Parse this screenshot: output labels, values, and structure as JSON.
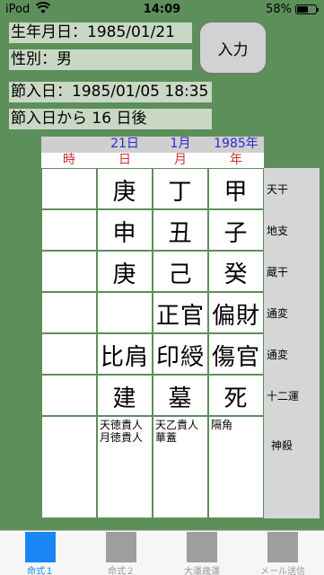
{
  "status": {
    "carrier": "iPod",
    "time": "14:09",
    "battery": "58%",
    "battery_level": 0.58
  },
  "info": {
    "birth": "生年月日：1985/01/21",
    "gender": "性別：男",
    "setsu": "節入日：1985/01/05 18:35",
    "days": "節入日から 16 日後"
  },
  "input_label": "入力",
  "columns": [
    {
      "date": "21日",
      "kind": "日"
    },
    {
      "date": "1月",
      "kind": "月"
    },
    {
      "date": "1985年",
      "kind": "年"
    }
  ],
  "hour_kind": "時",
  "colors": {
    "date": "#2a2ad0",
    "kind": "#d03030",
    "active_tab": "#1a86f5"
  },
  "rows": [
    {
      "label": "天干",
      "cells": [
        "",
        "庚",
        "丁",
        "甲"
      ]
    },
    {
      "label": "地支",
      "cells": [
        "",
        "申",
        "丑",
        "子"
      ]
    },
    {
      "label": "蔵干",
      "cells": [
        "",
        "庚",
        "己",
        "癸"
      ]
    },
    {
      "label": "通変",
      "cells": [
        "",
        "",
        "正官",
        "偏財"
      ]
    },
    {
      "label": "通変",
      "cells": [
        "",
        "比肩",
        "印綬",
        "傷官"
      ]
    },
    {
      "label": "十二運",
      "cells": [
        "",
        "建",
        "墓",
        "死"
      ]
    }
  ],
  "shinsatsu": {
    "label": "神殺",
    "cells": [
      "",
      "天徳貴人\n月徳貴人",
      "天乙貴人\n華蓋",
      "隔角"
    ]
  },
  "tabs": [
    {
      "label": "命式１",
      "active": true
    },
    {
      "label": "命式２",
      "active": false
    },
    {
      "label": "大運歳運",
      "active": false
    },
    {
      "label": "メール送信",
      "active": false
    }
  ]
}
